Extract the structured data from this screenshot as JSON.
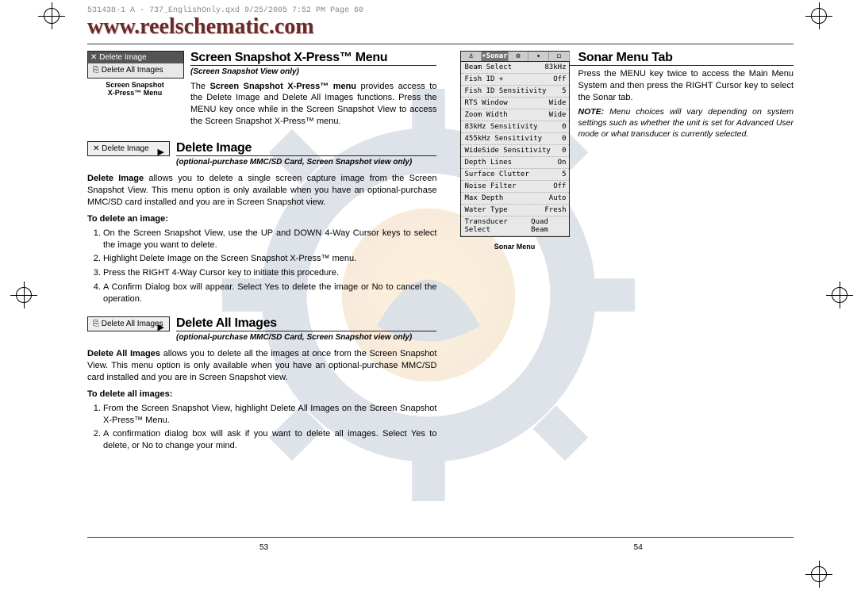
{
  "slug": "531438-1 A - 737_EnglishOnly.qxd  9/25/2005  7:52 PM  Page 60",
  "watermark_url": "www.reelschematic.com",
  "page_numbers": {
    "left": "53",
    "right": "54"
  },
  "left": {
    "xpress_menu_box": {
      "item1": "✕ Delete Image",
      "item2": "⎘ Delete All Images",
      "caption": "Screen Snapshot\nX-Press™ Menu"
    },
    "xpress": {
      "title": "Screen Snapshot X-Press™ Menu",
      "subhead": "(Screen Snapshot View only)",
      "para": "The Screen Snapshot X-Press™ menu provides access to the Delete Image and Delete All Images functions. Press the MENU key once while in the Screen Snapshot View to access the Screen Snapshot X-Press™ menu.",
      "boldspan": "Screen Snapshot X-Press™ menu"
    },
    "delete_image": {
      "icon_label": "✕ Delete Image",
      "title": "Delete Image",
      "subhead": "(optional-purchase MMC/SD Card, Screen Snapshot view only)",
      "para": "Delete Image allows you to delete a single screen capture image from the Screen Snapshot View. This menu option is only available when you have an optional-purchase MMC/SD card installed and you are in Screen Snapshot view.",
      "boldspan": "Delete Image",
      "howto_head": "To delete an image:",
      "steps": [
        "On the Screen Snapshot View, use the UP and DOWN 4-Way Cursor keys to select the image you want to delete.",
        "Highlight Delete Image on the Screen Snapshot X-Press™ menu.",
        "Press the RIGHT 4-Way Cursor key to initiate this procedure.",
        "A Confirm Dialog box will appear. Select Yes to delete the image or No to cancel the operation."
      ]
    },
    "delete_all": {
      "icon_label": "⎘ Delete All Images",
      "title": "Delete All Images",
      "subhead": "(optional-purchase MMC/SD Card, Screen Snapshot view only)",
      "para": "Delete All Images allows you to delete all the images at once from the Screen Snapshot View. This menu option is only available when you have an optional-purchase MMC/SD card installed and you are in Screen Snapshot view.",
      "boldspan": "Delete All Images",
      "howto_head": "To delete all images:",
      "steps": [
        "From the Screen Snapshot View, highlight Delete All Images on the Screen Snapshot X-Press™ Menu.",
        "A confirmation dialog box will ask if you want to delete all images. Select Yes to delete, or No to change your mind."
      ]
    }
  },
  "right": {
    "title": "Sonar Menu Tab",
    "para": "Press the MENU key twice to access the Main Menu System and then press the RIGHT Cursor key to select the Sonar tab.",
    "note_label": "NOTE:",
    "note": " Menu choices will vary depending on system settings such as whether the unit is set for Advanced User mode or what transducer is currently selected.",
    "menu_caption": "Sonar Menu",
    "tabs": [
      "⚓",
      "▾Sonar",
      "⚙",
      "✦",
      "◻"
    ],
    "menu_items": [
      {
        "k": "Beam Select",
        "v": "83kHz"
      },
      {
        "k": "Fish ID +",
        "v": "Off"
      },
      {
        "k": "Fish ID Sensitivity",
        "v": "5"
      },
      {
        "k": "RTS Window",
        "v": "Wide"
      },
      {
        "k": "Zoom Width",
        "v": "Wide"
      },
      {
        "k": "83kHz Sensitivity",
        "v": "0"
      },
      {
        "k": "455kHz Sensitivity",
        "v": "0"
      },
      {
        "k": "WideSide Sensitivity",
        "v": "0"
      },
      {
        "k": "Depth Lines",
        "v": "On"
      },
      {
        "k": "Surface Clutter",
        "v": "5"
      },
      {
        "k": "Noise Filter",
        "v": "Off"
      },
      {
        "k": "Max Depth",
        "v": "Auto"
      },
      {
        "k": "Water Type",
        "v": "Fresh"
      },
      {
        "k": "Transducer Select",
        "v": "Quad Beam"
      }
    ]
  }
}
